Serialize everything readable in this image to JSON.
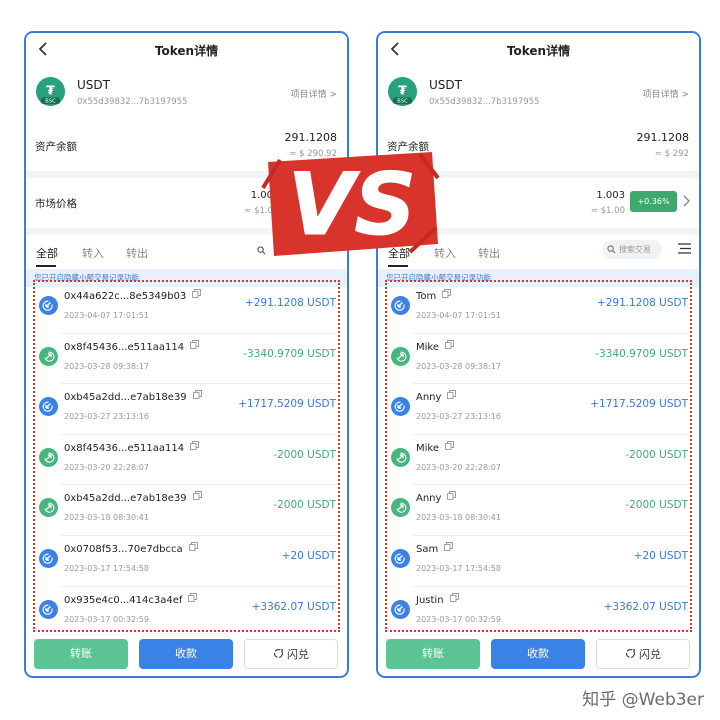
{
  "phones": [
    {
      "header": {
        "title": "Token详情"
      },
      "token": {
        "name": "USDT",
        "address": "0x55d39832...7b3197955",
        "project_link": "项目详情 >",
        "logo_symbol": "₮",
        "chain_badge": "BSC"
      },
      "asset": {
        "label": "资产余额",
        "value": "291.1208",
        "fiat": "≈ $ 290.92"
      },
      "price": {
        "label": "市场价格",
        "value": "1.00",
        "fiat": "≈ $1.0"
      },
      "tabs": [
        {
          "label": "全部"
        },
        {
          "label": "转入"
        },
        {
          "label": "转出"
        }
      ],
      "notice": "您已开启隐藏小额交易记录功能",
      "transactions": [
        {
          "name": "0x44a622c...8e5349b03",
          "time": "2023-04-07 17:01:51",
          "amount": "+291.1208 USDT",
          "direction": "in"
        },
        {
          "name": "0x8f45436...e511aa114",
          "time": "2023-03-28 09:38:17",
          "amount": "-3340.9709 USDT",
          "direction": "out"
        },
        {
          "name": "0xb45a2dd...e7ab18e39",
          "time": "2023-03-27 23:13:16",
          "amount": "+1717.5209 USDT",
          "direction": "in"
        },
        {
          "name": "0x8f45436...e511aa114",
          "time": "2023-03-20 22:28:07",
          "amount": "-2000 USDT",
          "direction": "out"
        },
        {
          "name": "0xb45a2dd...e7ab18e39",
          "time": "2023-03-18 08:30:41",
          "amount": "-2000 USDT",
          "direction": "out"
        },
        {
          "name": "0x0708f53...70e7dbcca",
          "time": "2023-03-17 17:54:58",
          "amount": "+20 USDT",
          "direction": "in"
        },
        {
          "name": "0x935e4c0...414c3a4ef",
          "time": "2023-03-17 00:32:59",
          "amount": "+3362.07 USDT",
          "direction": "in"
        }
      ],
      "buttons": {
        "transfer": "转账",
        "receive": "收款",
        "swap": "闪兑"
      }
    },
    {
      "header": {
        "title": "Token详情"
      },
      "token": {
        "name": "USDT",
        "address": "0x55d39832...7b3197955",
        "project_link": "项目详情 >",
        "logo_symbol": "₮",
        "chain_badge": "BSC"
      },
      "asset": {
        "label": "资产余额",
        "value": "291.1208",
        "fiat": "≈ $ 292"
      },
      "price": {
        "label": "",
        "value": "1.003",
        "fiat": "≈ $1.00",
        "change": "+0.36%"
      },
      "tabs": [
        {
          "label": "全部"
        },
        {
          "label": "转入"
        },
        {
          "label": "转出"
        }
      ],
      "search_placeholder": "搜索交易",
      "notice": "您已开启隐藏小额交易记录功能",
      "transactions": [
        {
          "name": "Tom",
          "time": "2023-04-07 17:01:51",
          "amount": "+291.1208 USDT",
          "direction": "in"
        },
        {
          "name": "Mike",
          "time": "2023-03-28 09:38:17",
          "amount": "-3340.9709 USDT",
          "direction": "out"
        },
        {
          "name": "Anny",
          "time": "2023-03-27 23:13:16",
          "amount": "+1717.5209 USDT",
          "direction": "in"
        },
        {
          "name": "Mike",
          "time": "2023-03-20 22:28:07",
          "amount": "-2000 USDT",
          "direction": "out"
        },
        {
          "name": "Anny",
          "time": "2023-03-18 08:30:41",
          "amount": "-2000 USDT",
          "direction": "out"
        },
        {
          "name": "Sam",
          "time": "2023-03-17 17:54:58",
          "amount": "+20 USDT",
          "direction": "in"
        },
        {
          "name": "Justin",
          "time": "2023-03-17 00:32:59",
          "amount": "+3362.07 USDT",
          "direction": "in"
        }
      ],
      "buttons": {
        "transfer": "转账",
        "receive": "收款",
        "swap": "闪兑"
      }
    }
  ],
  "overlay": {
    "vs_text": "VS"
  },
  "watermark": "知乎 @Web3er",
  "colors": {
    "frame_border": "#3f7ad8",
    "incoming": "#3d78d3",
    "outgoing": "#45a87a",
    "transfer_button": "#5cc394",
    "receive_button": "#3b82e6",
    "change_badge": "#3da96e",
    "highlight_dots": "#d9342b",
    "vs_red": "#d9342b"
  },
  "icons": {
    "back": "chevron-left-icon",
    "project": "chevron-right-icon",
    "token_logo": "tether-icon",
    "copy": "copy-icon",
    "search": "search-icon",
    "menu": "menu-icon",
    "tx_in": "arrow-in-icon",
    "tx_out": "arrow-out-icon",
    "swap": "swap-icon"
  }
}
